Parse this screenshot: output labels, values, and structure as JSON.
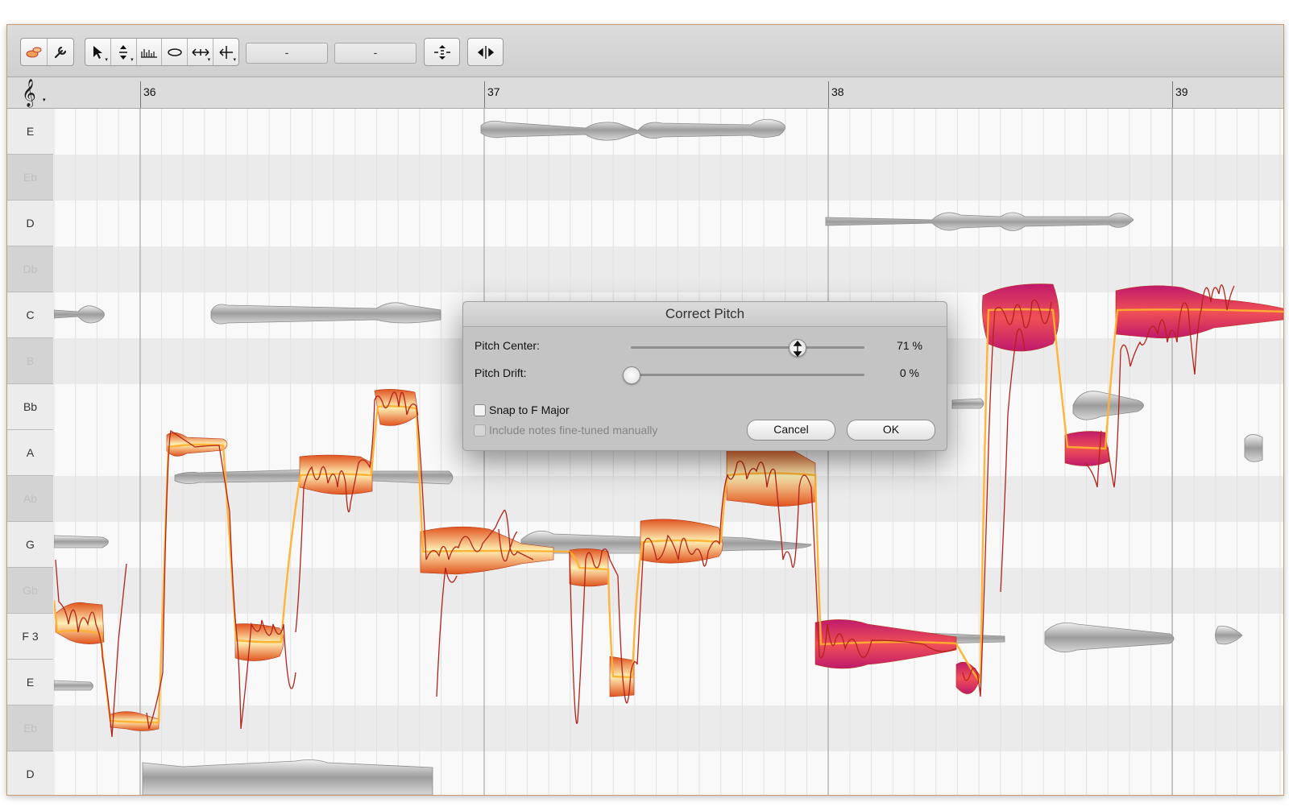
{
  "toolbar": {
    "tool_icons": [
      "blob-tool-icon",
      "wrench-icon"
    ],
    "edit_tools": [
      "pointer-icon",
      "pitch-tool-icon",
      "formant-tool-icon",
      "amplitude-tool-icon",
      "time-tool-icon",
      "note-separation-icon"
    ],
    "field1_value": "-",
    "field2_value": "-"
  },
  "ruler": {
    "bars": [
      {
        "label": "36",
        "x": 36
      },
      {
        "label": "37",
        "x": 37
      },
      {
        "label": "38",
        "x": 38
      },
      {
        "label": "39",
        "x": 39
      }
    ]
  },
  "keys": [
    {
      "label": "E",
      "type": "white"
    },
    {
      "label": "Eb",
      "type": "black"
    },
    {
      "label": "D",
      "type": "white"
    },
    {
      "label": "Db",
      "type": "black"
    },
    {
      "label": "C",
      "type": "white"
    },
    {
      "label": "B",
      "type": "black"
    },
    {
      "label": "Bb",
      "type": "white"
    },
    {
      "label": "A",
      "type": "white"
    },
    {
      "label": "Ab",
      "type": "black"
    },
    {
      "label": "G",
      "type": "white"
    },
    {
      "label": "Gb",
      "type": "black"
    },
    {
      "label": "F 3",
      "type": "white"
    },
    {
      "label": "E",
      "type": "white"
    },
    {
      "label": "Eb",
      "type": "black"
    },
    {
      "label": "D",
      "type": "white"
    }
  ],
  "dialog": {
    "title": "Correct Pitch",
    "pitch_center_label": "Pitch Center:",
    "pitch_center_value": "71 %",
    "pitch_center_level": 0.71,
    "pitch_drift_label": "Pitch Drift:",
    "pitch_drift_value": "0 %",
    "pitch_drift_level": 0,
    "snap_label": "Snap to F Major",
    "snap_checked": false,
    "include_label": "Include notes fine-tuned manually",
    "include_checked": false,
    "cancel_label": "Cancel",
    "ok_label": "OK"
  },
  "colors": {
    "blob_gray": "#b5b5b5",
    "corrected_warm": "#f0a040",
    "corrected_hot": "#d8286a",
    "pitch_line": "#b2231a",
    "corrected_line": "#ffb030"
  }
}
